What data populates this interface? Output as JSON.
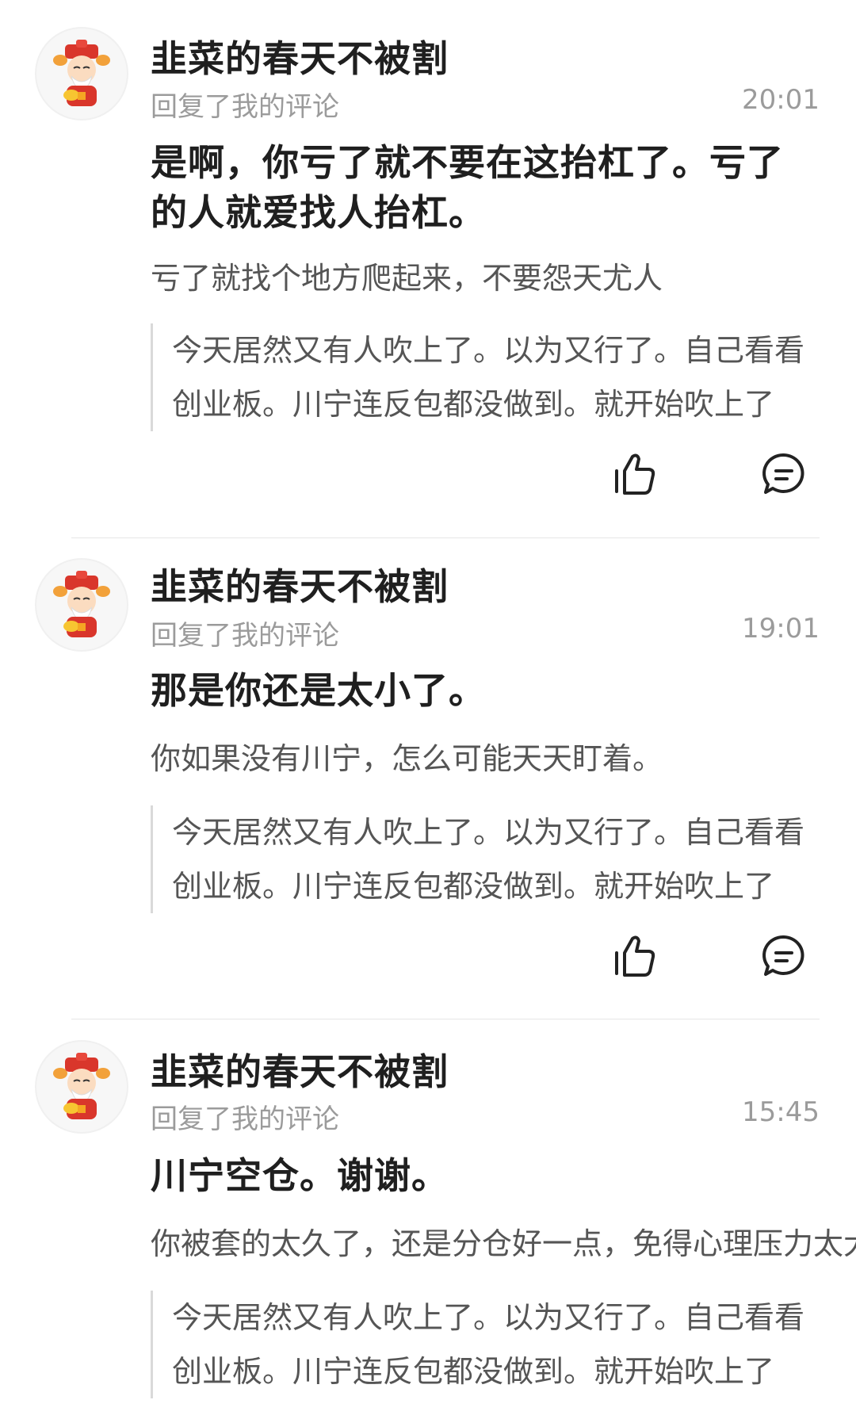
{
  "items": [
    {
      "username": "韭菜的春天不被割",
      "action": "回复了我的评论",
      "time": "20:01",
      "reply": "是啊，你亏了就不要在这抬杠了。亏了的人就爱找人抬杠。",
      "secondary": "亏了就找个地方爬起来，不要怨天尤人",
      "quote": "今天居然又有人吹上了。以为又行了。自己看看创业板。川宁连反包都没做到。就开始吹上了"
    },
    {
      "username": "韭菜的春天不被割",
      "action": "回复了我的评论",
      "time": "19:01",
      "reply": "那是你还是太小了。",
      "secondary": "你如果没有川宁，怎么可能天天盯着。",
      "quote": "今天居然又有人吹上了。以为又行了。自己看看创业板。川宁连反包都没做到。就开始吹上了"
    },
    {
      "username": "韭菜的春天不被割",
      "action": "回复了我的评论",
      "time": "15:45",
      "reply": "川宁空仓。谢谢。",
      "secondary": "你被套的太久了，还是分仓好一点，免得心理压力太大",
      "quote": "今天居然又有人吹上了。以为又行了。自己看看创业板。川宁连反包都没做到。就开始吹上了"
    }
  ],
  "icons": {
    "like": "thumbs-up-icon",
    "comment": "comment-bubble-icon",
    "avatar": "god-of-wealth-avatar"
  },
  "colors": {
    "primary_text": "#1f1f1f",
    "secondary_text": "#555555",
    "muted_text": "#9b9b9b",
    "quote_bar": "#d9d9d9",
    "divider": "#e6e6e6"
  }
}
